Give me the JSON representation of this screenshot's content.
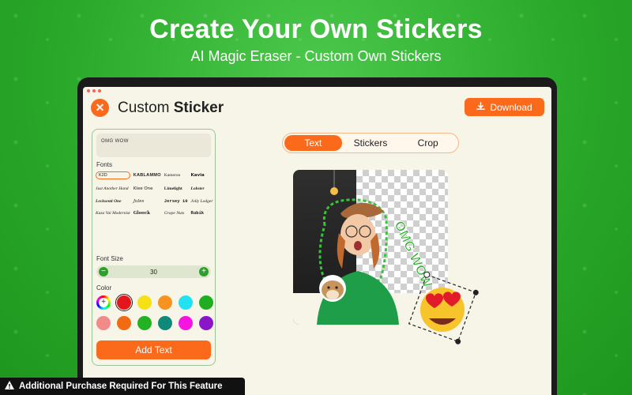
{
  "hero": {
    "title": "Create Your Own Stickers",
    "subtitle": "AI Magic Eraser - Custom Own Stickers"
  },
  "app": {
    "title_prefix": "Custom",
    "title_bold": "Sticker",
    "download_label": "Download",
    "accent_color": "#fa6a1a",
    "close_icon": "close-icon"
  },
  "panel": {
    "text_value": "OMG WOW",
    "fonts_label": "Fonts",
    "fonts": [
      "K2D",
      "KABLAMMO",
      "Kameron",
      "Kavia",
      "Just Another Hand",
      "Klee One",
      "Limelight",
      "Lobster",
      "Lecksenti One",
      "Jules",
      "Jersey 10",
      "Jolly Lodger",
      "Kaza Vai Modernist",
      "Gloock",
      "Grape Nuts",
      "Rubik"
    ],
    "selected_font": "K2D",
    "font_size_label": "Font Size",
    "font_size_value": "30",
    "color_label": "Color",
    "colors": [
      "picker",
      "#e5161b",
      "#f7e017",
      "#f7931e",
      "#22e1f0",
      "#1fae1f",
      "#f28a8a",
      "#f26b12",
      "#23b223",
      "#0d8a7a",
      "#f514e0",
      "#8a16c9"
    ],
    "selected_color": "#e5161b",
    "add_text_label": "Add Text"
  },
  "tabs": [
    {
      "label": "Text",
      "active": true
    },
    {
      "label": "Stickers",
      "active": false
    },
    {
      "label": "Crop",
      "active": false
    }
  ],
  "canvas": {
    "sticker_text": "OMG WOW"
  },
  "footer": {
    "warning": "Additional Purchase Required For This Feature",
    "warning_icon": "warning-icon"
  }
}
